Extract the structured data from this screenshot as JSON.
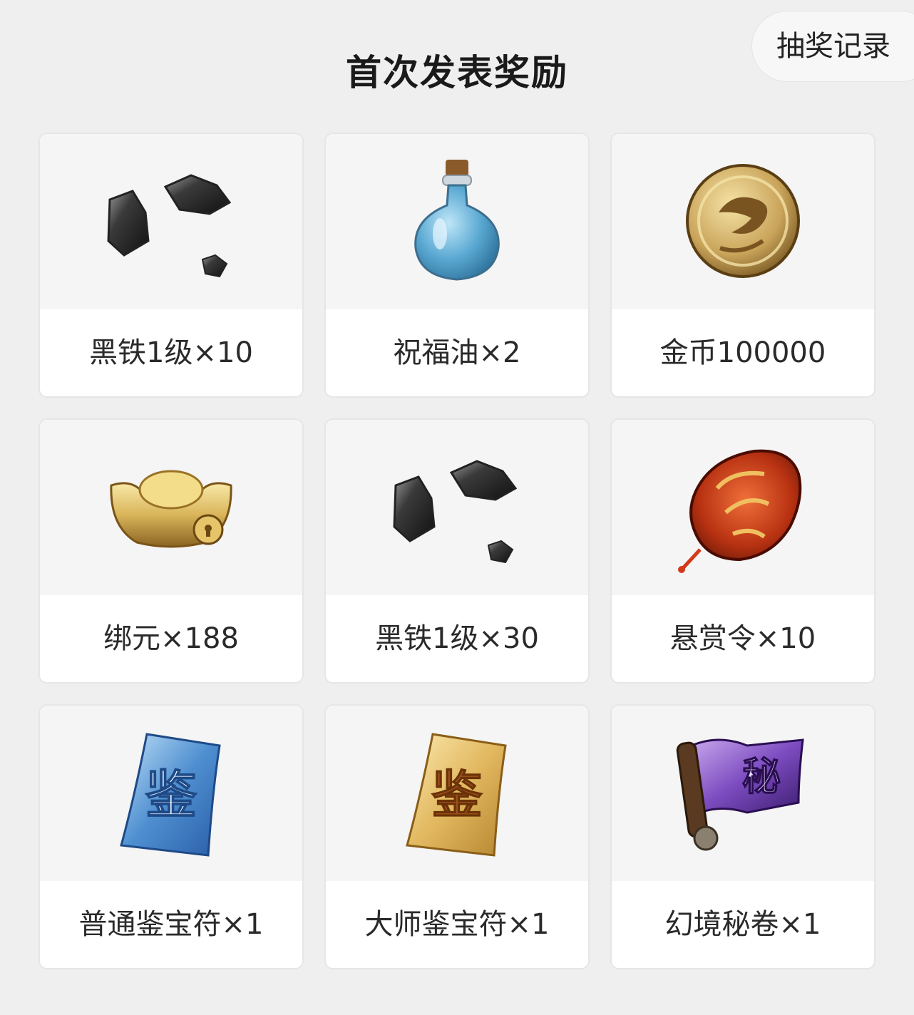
{
  "header": {
    "title": "首次发表奖励",
    "record_button": "抽奖记录"
  },
  "rewards": [
    {
      "label": "黑铁1级×10",
      "icon": "black-iron-ore-icon"
    },
    {
      "label": "祝福油×2",
      "icon": "blessing-oil-bottle-icon"
    },
    {
      "label": "金币100000",
      "icon": "gold-coin-icon"
    },
    {
      "label": "绑元×188",
      "icon": "gold-ingot-icon"
    },
    {
      "label": "黑铁1级×30",
      "icon": "black-iron-ore-icon"
    },
    {
      "label": "悬赏令×10",
      "icon": "bounty-token-icon"
    },
    {
      "label": "普通鉴宝符×1",
      "icon": "blue-appraisal-talisman-icon"
    },
    {
      "label": "大师鉴宝符×1",
      "icon": "gold-appraisal-talisman-icon"
    },
    {
      "label": "幻境秘卷×1",
      "icon": "secret-scroll-icon"
    }
  ],
  "icon_texts": {
    "appraisal": "鉴",
    "secret": "秘"
  },
  "colors": {
    "background": "#efefef",
    "card": "#ffffff",
    "image_area": "#f5f5f5"
  }
}
